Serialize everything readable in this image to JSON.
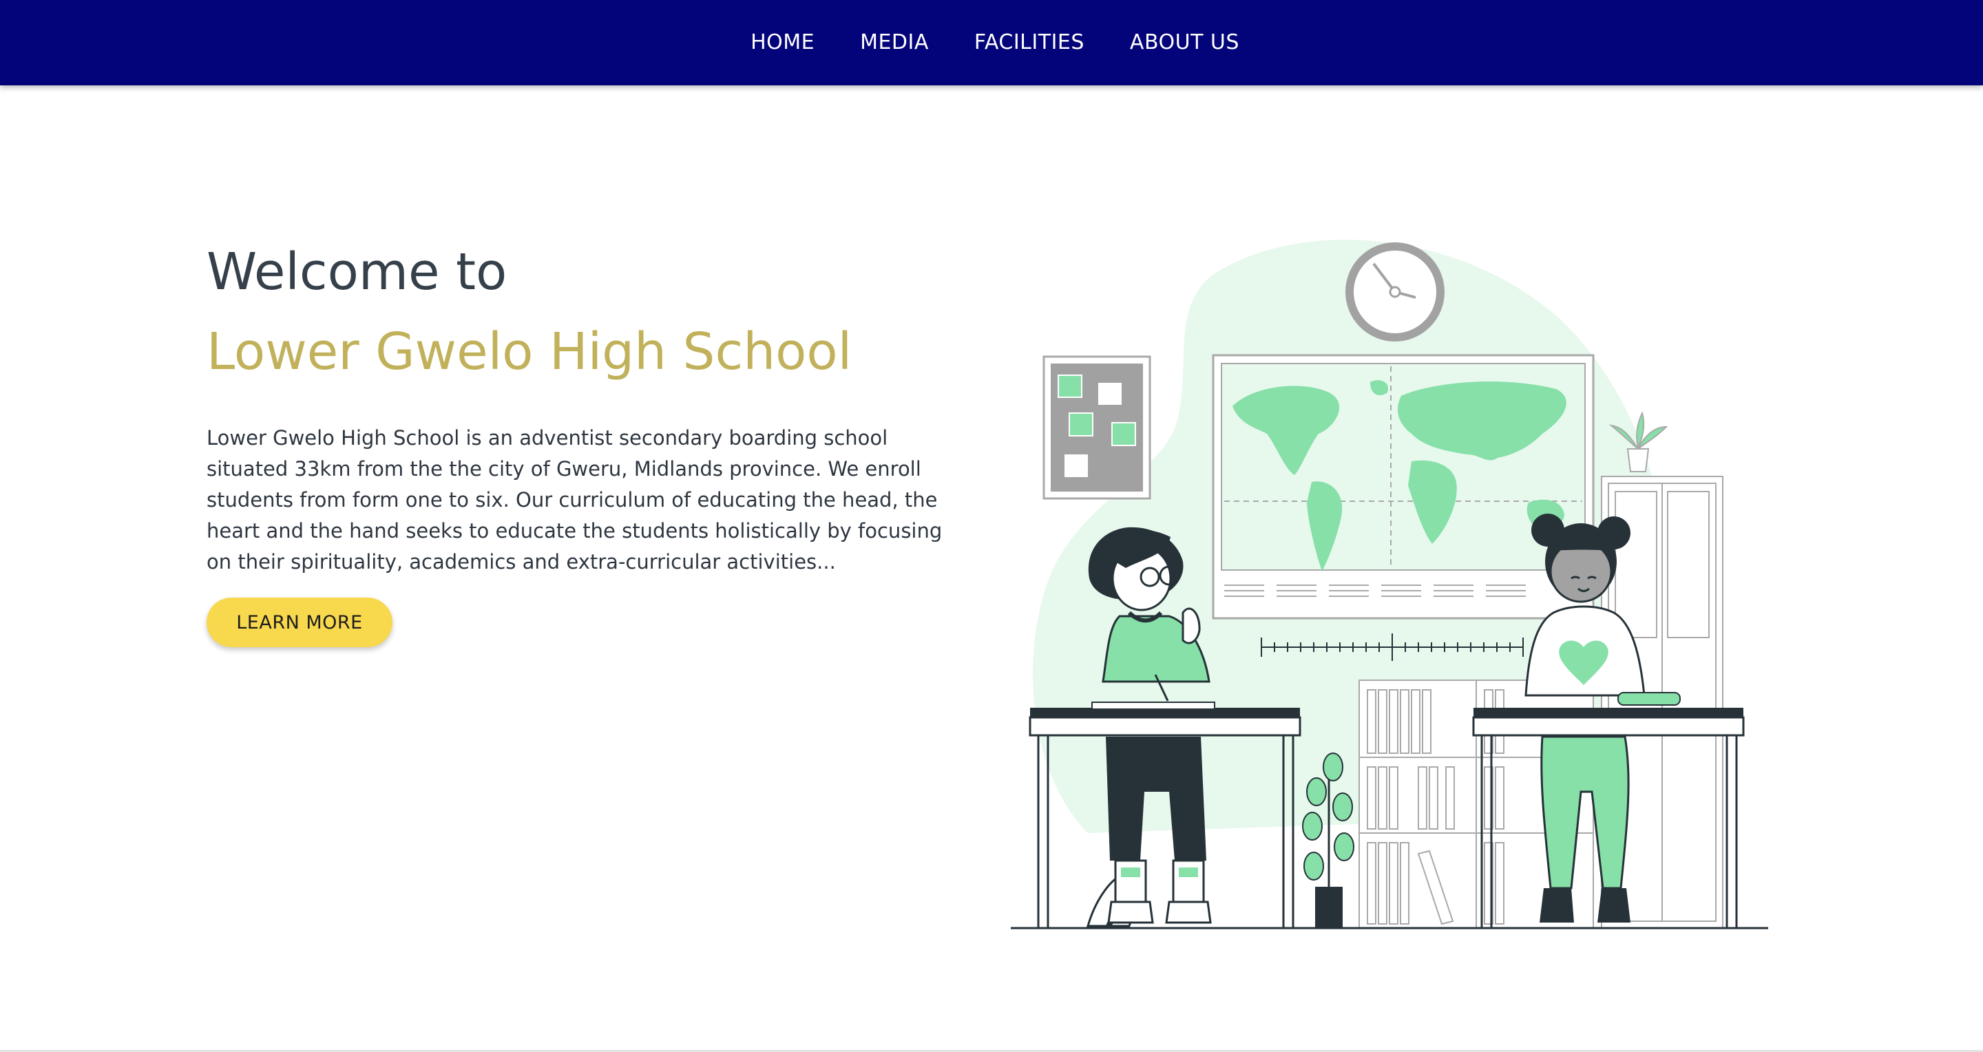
{
  "nav": {
    "items": [
      {
        "label": "HOME"
      },
      {
        "label": "MEDIA"
      },
      {
        "label": "FACILITIES"
      },
      {
        "label": "ABOUT US"
      }
    ]
  },
  "hero": {
    "welcome": "Welcome to",
    "school_name": "Lower Gwelo High School",
    "intro": "Lower Gwelo High School is an adventist secondary boarding school situated 33km from the the city of Gweru, Midlands province. We enroll students from form one to six. Our curriculum of educating the head, the heart and the hand seeks to educate the students holistically by focusing on their spirituality, academics and extra-curricular activities...",
    "cta_label": "LEARN MORE"
  },
  "colors": {
    "nav_background": "#03037a",
    "school_name": "#c1b15a",
    "cta": "#f8d84c",
    "illustration_accent": "#86e0a8"
  },
  "illustration": {
    "icons": [
      "clock-icon",
      "world-map-icon",
      "notice-board-icon",
      "plant-icon",
      "bookshelf-icon",
      "heart-icon"
    ]
  }
}
